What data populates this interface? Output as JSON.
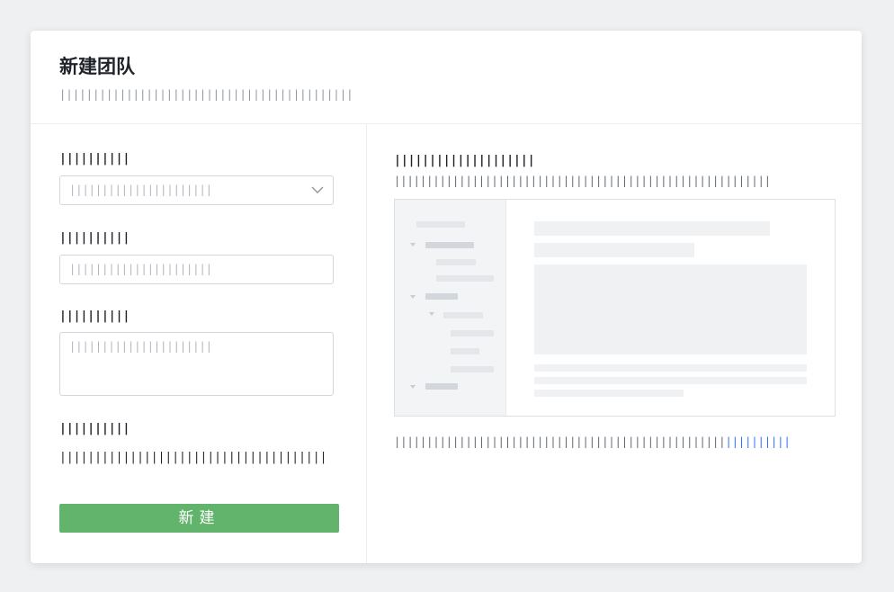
{
  "modal": {
    "title": "新建团队",
    "subtitle": "||||||||||||||||||||||||||||||||||||||||||||"
  },
  "form": {
    "field1": {
      "label": "||||||||||",
      "placeholder": "||||||||||||||||||||||"
    },
    "field2": {
      "label": "||||||||||",
      "placeholder": "||||||||||||||||||||||"
    },
    "field3": {
      "label": "||||||||||",
      "placeholder": "||||||||||||||||||||||"
    },
    "field4": {
      "label": "||||||||||",
      "value": "||||||||||||||||||||||||||||||||||||||"
    },
    "submit_label": "新建"
  },
  "preview_panel": {
    "title": "||||||||||||||||||||",
    "description": "||||||||||||||||||||||||||||||||||||||||||||||||||||||||||",
    "footer_text": "|||||||||||||||||||||||||||||||||||||||||||||||||||",
    "footer_link": "||||||||||"
  },
  "colors": {
    "submit_button": "#62b46c",
    "link": "#3370ff"
  }
}
